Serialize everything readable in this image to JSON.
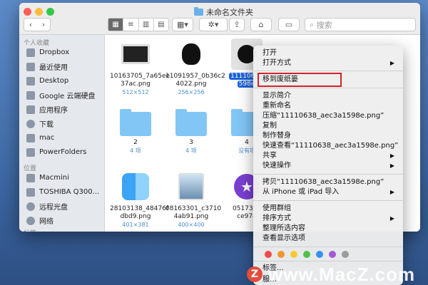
{
  "window": {
    "title": "未命名文件夹"
  },
  "toolbar": {
    "back": "‹",
    "forward": "›",
    "views": [
      "▦",
      "≡",
      "▥",
      "▤"
    ],
    "group": "▦▾",
    "action": "✲▾",
    "share": "⇪",
    "tag": "⌂",
    "new": "▭",
    "search_placeholder": "搜索"
  },
  "sidebar": {
    "sections": {
      "favorites": "个人收藏",
      "locations": "位置",
      "tags": "标签"
    },
    "favorites": [
      "Dropbox",
      "最近使用",
      "Desktop",
      "Google 云端硬盘",
      "应用程序",
      "下载",
      "mac",
      "PowerFolders"
    ],
    "locations": [
      "Macmini",
      "TOSHIBA Q300...",
      "远程光盘",
      "网络"
    ]
  },
  "files": [
    {
      "name1": "10163705_7a65ee",
      "name2": "37ac.png",
      "sub": "512×512"
    },
    {
      "name1": "11091957_0b36c2",
      "name2": "4022.png",
      "sub": "256×256"
    },
    {
      "name1": "11110638",
      "name2": "598e",
      "sub": ""
    },
    {
      "name1": "2",
      "name2": "",
      "sub": "4 项"
    },
    {
      "name1": "3",
      "name2": "",
      "sub": "4 项"
    },
    {
      "name1": "4",
      "name2": "",
      "sub": "没有项"
    },
    {
      "name1": "28103138_48476f",
      "name2": "dbd9.png",
      "sub": "401×381"
    },
    {
      "name1": "08163301_c3710",
      "name2": "4ab91.png",
      "sub": "400×400"
    },
    {
      "name1": "0517365",
      "name2": "ce974",
      "sub": ""
    }
  ],
  "menu": {
    "open": "打开",
    "open_with": "打开方式",
    "move_trash": "移到废纸篓",
    "info": "显示简介",
    "rename": "重新命名",
    "compress": "压缩“11110638_aec3a1598e.png”",
    "duplicate": "复制",
    "alias": "制作替身",
    "quicklook": "快速查看“11110638_aec3a1598e.png”",
    "share": "共享",
    "quick_actions": "快速操作",
    "copy": "拷贝“11110638_aec3a1598e.png”",
    "import": "从 iPhone 或 iPad 导入",
    "use_groups": "使用群组",
    "sort_by": "排序方式",
    "clean_up": "整理所选内容",
    "view_options": "查看显示选项",
    "tags": "标签...",
    "partial": "服…",
    "arrow": "▶"
  },
  "tag_colors": [
    "#ee4b4b",
    "#f2962f",
    "#f6c935",
    "#50c04b",
    "#3a8ff0",
    "#a35ad6",
    "#9a9a9a"
  ],
  "watermark": {
    "logo": "Z",
    "text": "www.MacZ.com"
  }
}
